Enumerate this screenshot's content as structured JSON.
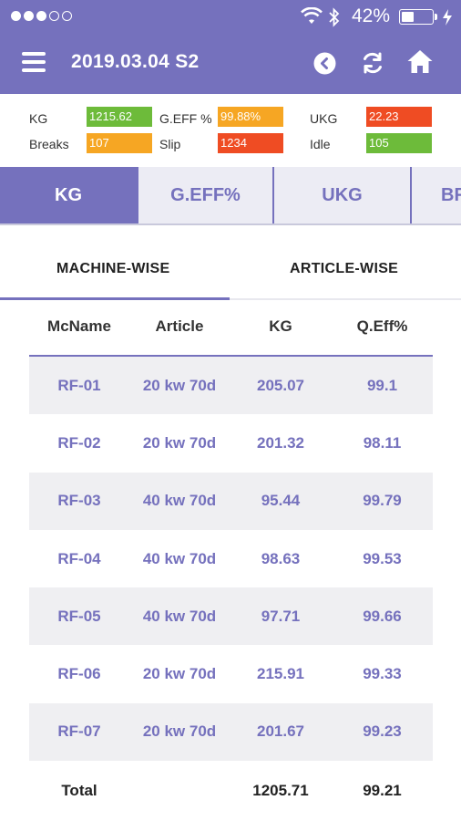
{
  "status_bar": {
    "signal_dots": [
      true,
      true,
      true,
      false,
      false
    ],
    "battery_text": "42%",
    "battery_level": 0.42
  },
  "header": {
    "title": "2019.03.04 S2"
  },
  "colors": {
    "primary": "#7571bd",
    "green": "#6dbb3a",
    "orange": "#f6a623",
    "red": "#ef4c23",
    "row_shade": "#efeff2"
  },
  "stats": {
    "kg": {
      "label": "KG",
      "value": "1215.62",
      "color": "green"
    },
    "geff": {
      "label": "G.EFF %",
      "value": "99.88%",
      "color": "orange"
    },
    "ukg": {
      "label": "UKG",
      "value": "22.23",
      "color": "red"
    },
    "breaks": {
      "label": "Breaks",
      "value": "107",
      "color": "orange"
    },
    "slip": {
      "label": "Slip",
      "value": "1234",
      "color": "red"
    },
    "idle": {
      "label": "Idle",
      "value": "105",
      "color": "green"
    }
  },
  "metric_tabs": [
    "KG",
    "G.EFF%",
    "UKG",
    "BR"
  ],
  "metric_tabs_active": "KG",
  "subtabs": {
    "machine": "MACHINE-WISE",
    "article": "ARTICLE-WISE",
    "active": "MACHINE-WISE"
  },
  "table": {
    "headers": [
      "McName",
      "Article",
      "KG",
      "Q.Eff%"
    ],
    "rows": [
      [
        "RF-01",
        "20 kw 70d",
        "205.07",
        "99.1"
      ],
      [
        "RF-02",
        "20 kw 70d",
        "201.32",
        "98.11"
      ],
      [
        "RF-03",
        "40 kw 70d",
        "95.44",
        "99.79"
      ],
      [
        "RF-04",
        "40 kw 70d",
        "98.63",
        "99.53"
      ],
      [
        "RF-05",
        "40 kw 70d",
        "97.71",
        "99.66"
      ],
      [
        "RF-06",
        "20 kw 70d",
        "215.91",
        "99.33"
      ],
      [
        "RF-07",
        "20 kw 70d",
        "201.67",
        "99.23"
      ]
    ],
    "total": [
      "Total",
      "",
      "1205.71",
      "99.21"
    ]
  },
  "icons": {
    "menu": "menu-icon",
    "back": "back-circle-icon",
    "refresh": "refresh-icon",
    "home": "home-icon",
    "wifi": "wifi-icon",
    "bluetooth": "bluetooth-icon",
    "battery": "battery-icon",
    "charging": "charging-bolt-icon"
  }
}
